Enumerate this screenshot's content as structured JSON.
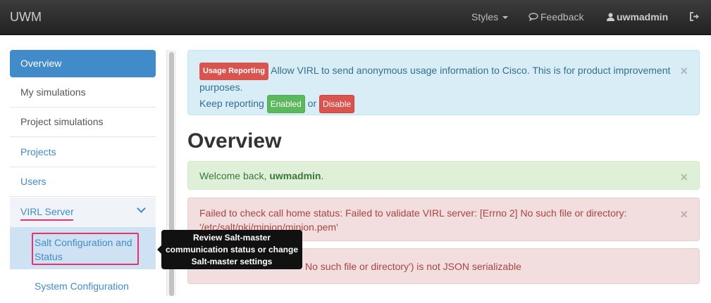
{
  "navbar": {
    "brand": "UWM",
    "styles_label": "Styles",
    "feedback_label": "Feedback",
    "user_label": "uwmadmin"
  },
  "sidebar": {
    "items": [
      {
        "label": "Overview"
      },
      {
        "label": "My simulations"
      },
      {
        "label": "Project simulations"
      },
      {
        "label": "Projects"
      },
      {
        "label": "Users"
      },
      {
        "label": "VIRL Server"
      }
    ],
    "subitems": [
      {
        "label": "Salt Configuration and Status"
      },
      {
        "label": "System Configuration"
      }
    ]
  },
  "tooltip": {
    "line1": "Review Salt-master",
    "line2": "communication status or change",
    "line3": "Salt-master settings"
  },
  "main": {
    "usage_alert": {
      "badge": "Usage Reporting",
      "text": "Allow VIRL to send anonymous usage information to Cisco. This is for product improvement purposes.",
      "keep_text": "Keep reporting",
      "enabled_label": "Enabled",
      "or_text": "or",
      "disable_label": "Disable",
      "close": "×"
    },
    "title": "Overview",
    "welcome_alert": {
      "prefix": "Welcome back,",
      "user": "uwmadmin",
      "suffix": ".",
      "close": "×"
    },
    "error_alert_1": {
      "line1": "Failed to check call home status: Failed to validate VIRL server: [Errno 2] No such file or directory:",
      "line2": "'/etc/salt/pki/minion/minion.pem'",
      "close": "×"
    },
    "error_alert_2": {
      "visible_text": "such file or directory') is not JSON serializable",
      "partial_prefix": "'/etc/salt/pki/minion/minion.pem'",
      "partial_word": "No"
    }
  },
  "colors": {
    "primary": "#428bca",
    "highlight": "#e8336c",
    "navbar": "#222222"
  }
}
